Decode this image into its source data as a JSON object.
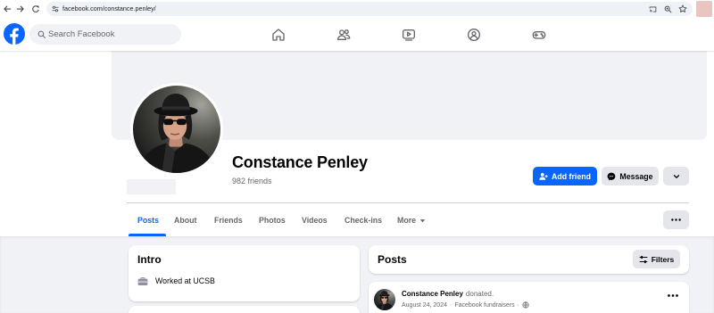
{
  "browser": {
    "url": "facebook.com/constance.penley/",
    "icons": [
      "back-icon",
      "forward-icon",
      "reload-icon",
      "site-info-icon",
      "cast-icon",
      "zoom-icon",
      "bookmark-star-icon"
    ]
  },
  "header": {
    "logo": "facebook-logo-icon",
    "search_placeholder": "Search Facebook",
    "nav_icons": [
      "home-icon",
      "friends-icon",
      "watch-icon",
      "groups-icon",
      "gaming-icon"
    ]
  },
  "profile": {
    "name": "Constance Penley",
    "friends_count": "982 friends"
  },
  "actions": {
    "add_friend": "Add friend",
    "message": "Message"
  },
  "tabs": [
    {
      "label": "Posts",
      "active": true
    },
    {
      "label": "About",
      "active": false
    },
    {
      "label": "Friends",
      "active": false
    },
    {
      "label": "Photos",
      "active": false
    },
    {
      "label": "Videos",
      "active": false
    },
    {
      "label": "Check-ins",
      "active": false
    },
    {
      "label": "More",
      "active": false,
      "dropdown": true
    }
  ],
  "intro": {
    "title": "Intro",
    "items": [
      {
        "icon": "work-icon",
        "text": "Worked at UCSB"
      }
    ]
  },
  "posts": {
    "title": "Posts",
    "filters_label": "Filters"
  },
  "post": {
    "author": "Constance Penley",
    "action": "donated.",
    "date": "August 24, 2024",
    "separator": "·",
    "source": "Facebook fundraisers",
    "audience_icon": "globe-icon"
  },
  "colors": {
    "brand_blue": "#0866ff",
    "surface": "#f0f2f5",
    "button_gray": "#e4e6eb",
    "text_primary": "#050505",
    "text_secondary": "#65676b"
  }
}
